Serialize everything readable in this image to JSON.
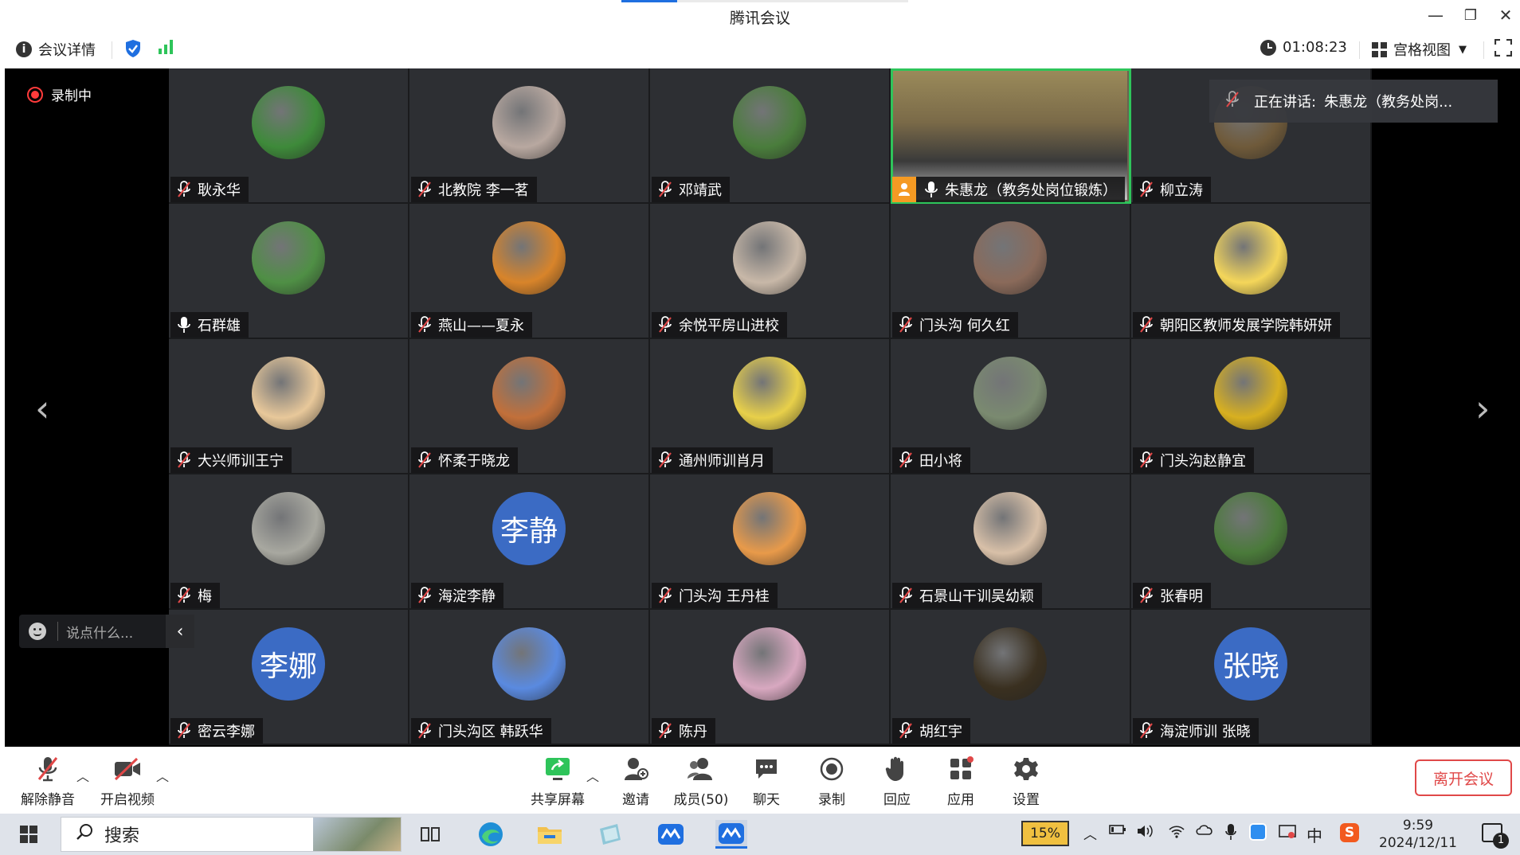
{
  "window": {
    "title": "腾讯会议",
    "minimize": "—",
    "restore": "❐",
    "close": "✕"
  },
  "infobar": {
    "details_label": "会议详情",
    "timer": "01:08:23",
    "view_label": "宫格视图"
  },
  "stage": {
    "recording_label": "录制中",
    "speaking_label": "正在讲话:",
    "speaking_name": "朱惠龙（教务处岗...",
    "chat_placeholder": "说点什么...",
    "chat_toggle": "‹",
    "prev_arrow": "‹",
    "next_arrow": "›"
  },
  "participants": [
    {
      "name": "耿永华",
      "mic": "muted",
      "avatar": "photo",
      "color": "#3e8a3a"
    },
    {
      "name": "北教院 李一茗",
      "mic": "muted",
      "avatar": "photo",
      "color": "#b8a8a0"
    },
    {
      "name": "邓靖武",
      "mic": "muted",
      "avatar": "photo",
      "color": "#4a7d3c"
    },
    {
      "name": "朱惠龙（教务处岗位锻炼）",
      "mic": "on",
      "avatar": "video",
      "color": "#7a6a4c",
      "active": true
    },
    {
      "name": "柳立涛",
      "mic": "muted",
      "avatar": "photo",
      "color": "#6f5a3a"
    },
    {
      "name": "石群雄",
      "mic": "on",
      "avatar": "photo",
      "color": "#4f8f45"
    },
    {
      "name": "燕山——夏永",
      "mic": "muted",
      "avatar": "photo",
      "color": "#d8842a"
    },
    {
      "name": "余悦平房山进校",
      "mic": "muted",
      "avatar": "photo",
      "color": "#c8b8a8"
    },
    {
      "name": "门头沟  何久红",
      "mic": "muted",
      "avatar": "photo",
      "color": "#8a6a5a"
    },
    {
      "name": "朝阳区教师发展学院韩妍妍",
      "mic": "muted",
      "avatar": "photo",
      "color": "#f4d65a"
    },
    {
      "name": "大兴师训王宁",
      "mic": "muted",
      "avatar": "photo",
      "color": "#e8c89a"
    },
    {
      "name": "怀柔于晓龙",
      "mic": "muted",
      "avatar": "photo",
      "color": "#c2703a"
    },
    {
      "name": "通州师训肖月",
      "mic": "muted",
      "avatar": "photo",
      "color": "#e8d04a"
    },
    {
      "name": "田小将",
      "mic": "muted",
      "avatar": "photo",
      "color": "#7a8a70"
    },
    {
      "name": "门头沟赵静宜",
      "mic": "muted",
      "avatar": "photo",
      "color": "#d8b020"
    },
    {
      "name": "梅",
      "mic": "muted",
      "avatar": "photo",
      "color": "#a8a8a0"
    },
    {
      "name": "海淀李静",
      "mic": "muted",
      "avatar": "text",
      "avatar_text": "李静",
      "color": "#3b6bc4"
    },
    {
      "name": "门头沟  王丹桂",
      "mic": "muted",
      "avatar": "photo",
      "color": "#e89a4a"
    },
    {
      "name": "石景山干训吴幼颖",
      "mic": "muted",
      "avatar": "photo",
      "color": "#d8c0a8"
    },
    {
      "name": "张春明",
      "mic": "muted",
      "avatar": "photo",
      "color": "#4a7a3a"
    },
    {
      "name": "密云李娜",
      "mic": "muted",
      "avatar": "text",
      "avatar_text": "李娜",
      "color": "#3b6bc4"
    },
    {
      "name": "门头沟区  韩跃华",
      "mic": "muted",
      "avatar": "photo",
      "color": "#5a8ae0"
    },
    {
      "name": "陈丹",
      "mic": "muted",
      "avatar": "photo",
      "color": "#d8a8c0"
    },
    {
      "name": "胡红宇",
      "mic": "muted",
      "avatar": "photo",
      "color": "#3a3020"
    },
    {
      "name": "海淀师训 张晓",
      "mic": "muted",
      "avatar": "text",
      "avatar_text": "张晓",
      "color": "#3b6bc4"
    }
  ],
  "toolbar": {
    "unmute": "解除静音",
    "start_video": "开启视频",
    "share_screen": "共享屏幕",
    "invite": "邀请",
    "members": "成员(50)",
    "chat": "聊天",
    "record": "录制",
    "react": "回应",
    "apps": "应用",
    "settings": "设置",
    "leave": "离开会议"
  },
  "taskbar": {
    "search_label": "搜索",
    "battery": "15%",
    "ime": "中",
    "time": "9:59",
    "date": "2024/12/11",
    "notifications": "1"
  }
}
